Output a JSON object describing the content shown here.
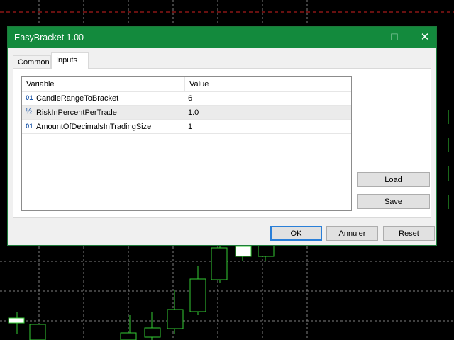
{
  "colors": {
    "titlebar": "#138a3d",
    "grid_dash": "#808080",
    "red_dash": "#d11f1f",
    "candle_border": "#33cc33",
    "icon_blue": "#1a55a8"
  },
  "window": {
    "title": "EasyBracket 1.00",
    "minimize_glyph": "—",
    "maximize_glyph": "☐",
    "close_glyph": "✕"
  },
  "tabs": [
    {
      "label": "Common",
      "active": false
    },
    {
      "label": "Inputs",
      "active": true
    }
  ],
  "inputs_table": {
    "headers": {
      "variable": "Variable",
      "value": "Value"
    },
    "rows": [
      {
        "icon": "integer-icon",
        "icon_glyph": "01",
        "name": "CandleRangeToBracket",
        "value": "6"
      },
      {
        "icon": "fraction-icon",
        "icon_glyph": "½",
        "name": "RiskInPercentPerTrade",
        "value": "1.0"
      },
      {
        "icon": "integer-icon",
        "icon_glyph": "01",
        "name": "AmountOfDecimalsInTradingSize",
        "value": "1"
      }
    ]
  },
  "side_buttons": {
    "load": "Load",
    "save": "Save"
  },
  "footer_buttons": {
    "ok": "OK",
    "cancel": "Annuler",
    "reset": "Reset"
  }
}
